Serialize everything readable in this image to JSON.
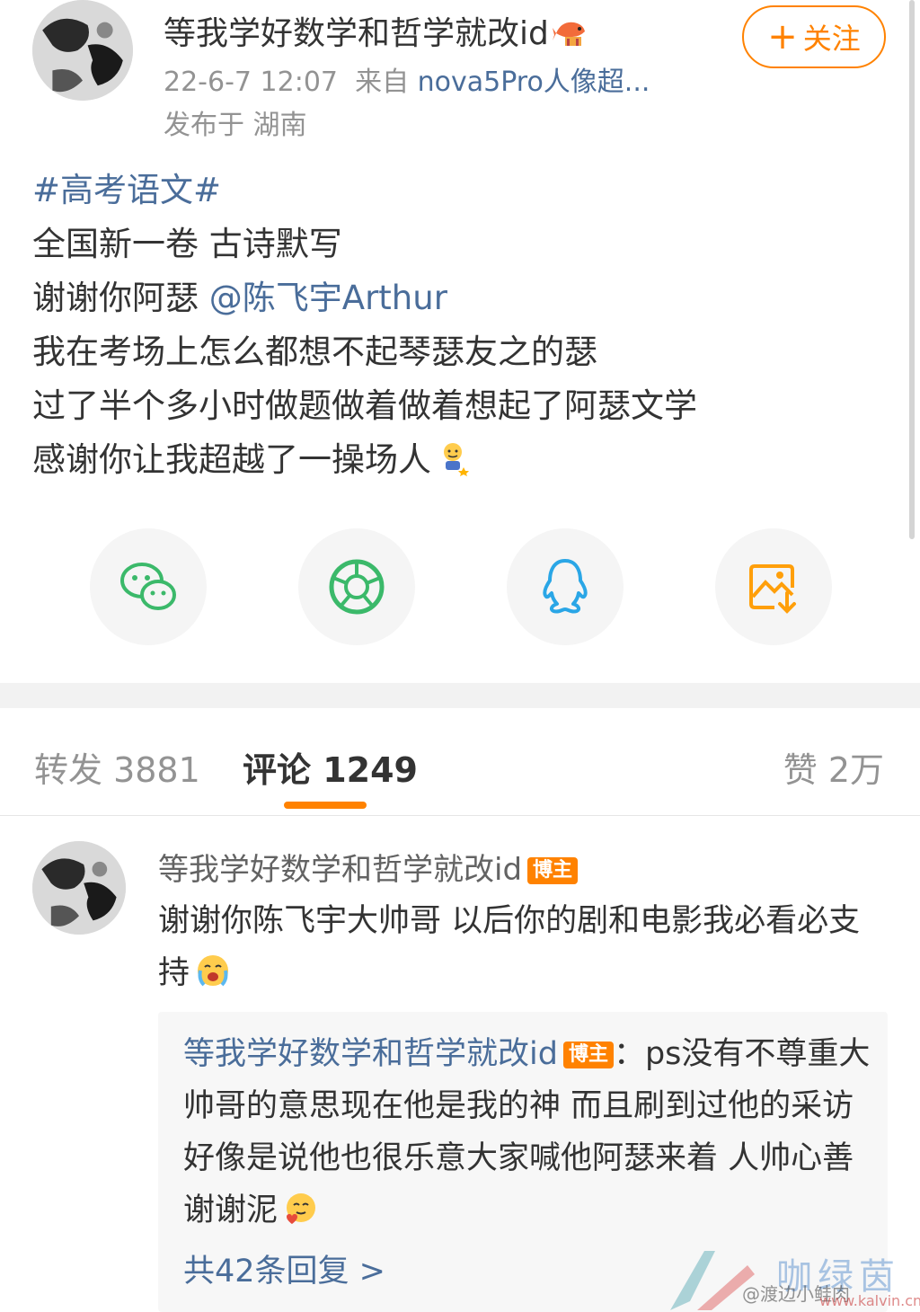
{
  "post": {
    "author_name": "等我学好数学和哲学就改id",
    "author_badge_icon": "koi-fish-icon",
    "timestamp": "22-6-7 12:07",
    "source_prefix": "来自",
    "source_device": "nova5Pro人像超...",
    "location": "发布于 湖南",
    "follow_label": "关注",
    "body": {
      "hashtag": "#高考语文#",
      "line2": "全国新一卷 古诗默写",
      "line3_text": "谢谢你阿瑟 ",
      "line3_mention": "@陈飞宇Arthur",
      "line4": "我在考场上怎么都想不起琴瑟友之的瑟",
      "line5": "过了半个多小时做题做着做着想起了阿瑟文学",
      "line6": "感谢你让我超越了一操场人"
    }
  },
  "share": {
    "items": [
      "wechat-icon",
      "moments-icon",
      "qq-icon",
      "save-image-icon"
    ],
    "colors": {
      "wechat": "#3bb96a",
      "moments": "#3bb96a",
      "qq": "#2aa6e6",
      "save": "#ff9f0a"
    }
  },
  "tabs": {
    "reposts": "转发 3881",
    "comments": "评论 1249",
    "likes": "赞 2万"
  },
  "comment": {
    "author_name": "等我学好数学和哲学就改id",
    "author_badge": "博主",
    "text": "谢谢你陈飞宇大帅哥 以后你的剧和电影我必看必支持",
    "reply": {
      "author_name": "等我学好数学和哲学就改id",
      "author_badge": "博主",
      "text": "：ps没有不尊重大帅哥的意思现在他是我的神 而且刷到过他的采访好像是说他也很乐意大家喊他阿瑟来着 人帅心善谢谢泥",
      "count_label": "共42条回复 >"
    }
  },
  "watermark": {
    "site_name": "咖绿茵",
    "handle": "@渡边小鲑肉",
    "url": "www.kalvin.cn"
  },
  "colors": {
    "accent": "#ff8200",
    "link": "#4a6d9a",
    "muted": "#939393"
  }
}
